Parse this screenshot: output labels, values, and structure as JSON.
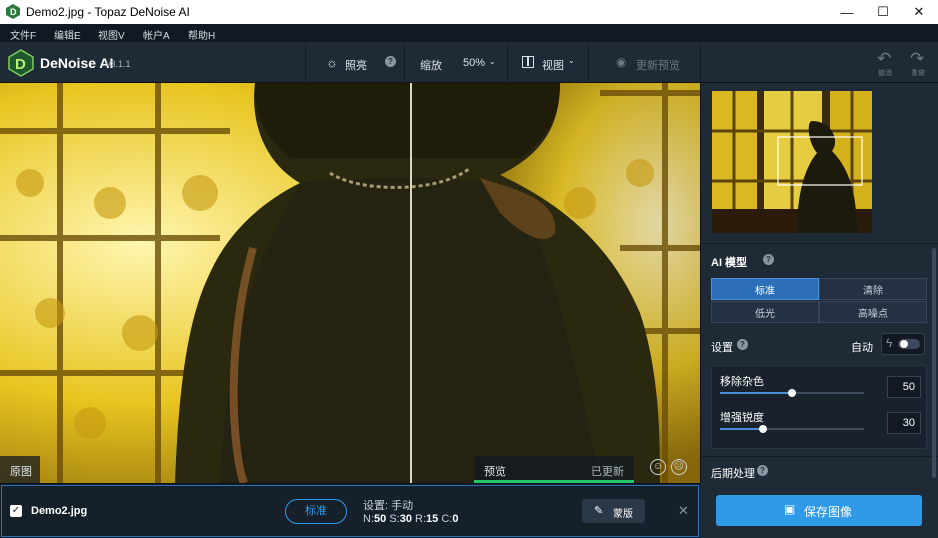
{
  "window": {
    "title": "Demo2.jpg - Topaz DeNoise AI",
    "minimize": "—",
    "maximize": "☐",
    "close": "✕"
  },
  "menu": [
    "文件F",
    "编辑E",
    "视图V",
    "帐户A",
    "帮助H"
  ],
  "app": {
    "name": "DeNoise AI",
    "version": "v3.1.1"
  },
  "toolbar": {
    "brightness_label": "照亮",
    "zoom_label": "缩放",
    "zoom_value": "50%",
    "view_label": "视图",
    "update_preview_label": "更新预览",
    "undo_label": "撤消",
    "redo_label": "重做"
  },
  "viewport": {
    "original_label": "原图",
    "preview_label": "预览",
    "preview_status": "已更新",
    "preview_progress": 1.0
  },
  "file_bar": {
    "checked": true,
    "filename": "Demo2.jpg",
    "model_button": "标准",
    "settings_line": "设置: 手动",
    "stats": [
      {
        "key": "N:",
        "value": "50"
      },
      {
        "key": "S:",
        "value": "30"
      },
      {
        "key": "R:",
        "value": "15"
      },
      {
        "key": "C:",
        "value": "0"
      }
    ],
    "mask_button": "蒙版",
    "close": "✕"
  },
  "panel": {
    "ai_model_title": "AI 模型",
    "models": [
      "标准",
      "清除",
      "低光",
      "高噪点"
    ],
    "selected_model": "标准",
    "settings_title": "设置",
    "auto_label": "自动",
    "auto_enabled": false,
    "sliders": [
      {
        "label": "移除杂色",
        "value": "50",
        "fraction": 0.5
      },
      {
        "label": "增强锐度",
        "value": "30",
        "fraction": 0.3
      }
    ],
    "post_process_title": "后期处理",
    "save_button": "保存图像"
  },
  "colors": {
    "accent": "#2f9be8",
    "selected": "#2d6fb7",
    "progress": "#27c46a"
  }
}
